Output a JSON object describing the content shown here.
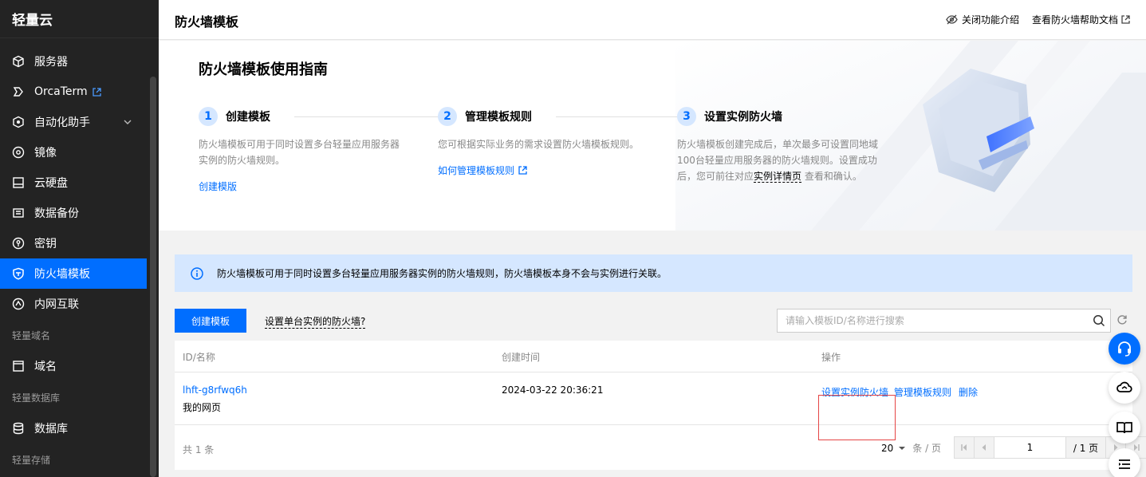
{
  "sidebar": {
    "brand": "轻量云",
    "items": [
      {
        "label": "服务器"
      },
      {
        "label": "OrcaTerm"
      },
      {
        "label": "自动化助手"
      },
      {
        "label": "镜像"
      },
      {
        "label": "云硬盘"
      },
      {
        "label": "数据备份"
      },
      {
        "label": "密钥"
      },
      {
        "label": "防火墙模板"
      },
      {
        "label": "内网互联"
      }
    ],
    "groups": [
      "轻量域名",
      "轻量数据库",
      "轻量存储"
    ],
    "domain_item": {
      "label": "域名"
    },
    "database_item": {
      "label": "数据库"
    }
  },
  "header": {
    "title": "防火墙模板",
    "close_intro": "关闭功能介绍",
    "help_doc": "查看防火墙帮助文档"
  },
  "guide": {
    "title": "防火墙模板使用指南",
    "steps": [
      {
        "num": "1",
        "title": "创建模板",
        "desc": "防火墙模板可用于同时设置多台轻量应用服务器实例的防火墙规则。",
        "link": "创建模版"
      },
      {
        "num": "2",
        "title": "管理模板规则",
        "desc": "您可根据实际业务的需求设置防火墙模板规则。",
        "link": "如何管理模板规则"
      },
      {
        "num": "3",
        "title": "设置实例防火墙",
        "desc_before": "防火墙模板创建完成后，单次最多可设置同地域100台轻量应用服务器的防火墙规则。设置成功后，您可前往对应",
        "desc_link": "实例详情页",
        "desc_after": "查看和确认。"
      }
    ]
  },
  "notice": {
    "text": "防火墙模板可用于同时设置多台轻量应用服务器实例的防火墙规则，防火墙模板本身不会与实例进行关联。"
  },
  "toolbar": {
    "create_label": "创建模板",
    "single_link": "设置单台实例的防火墙?",
    "search_placeholder": "请输入模板ID/名称进行搜索"
  },
  "table": {
    "columns": [
      "ID/名称",
      "创建时间",
      "操作"
    ],
    "rows": [
      {
        "id": "lhft-g8rfwq6h",
        "name": "我的网页",
        "created": "2024-03-22 20:36:21",
        "actions": [
          "设置实例防火墙",
          "管理模板规则",
          "删除"
        ]
      }
    ],
    "total": "共 1 条",
    "page_size": "20",
    "page_size_unit": "条 / 页",
    "current_page": "1",
    "total_pages": "/ 1 页"
  },
  "colors": {
    "accent": "#006eff",
    "sidebar_bg": "#232323",
    "highlight_border": "#e54545"
  }
}
